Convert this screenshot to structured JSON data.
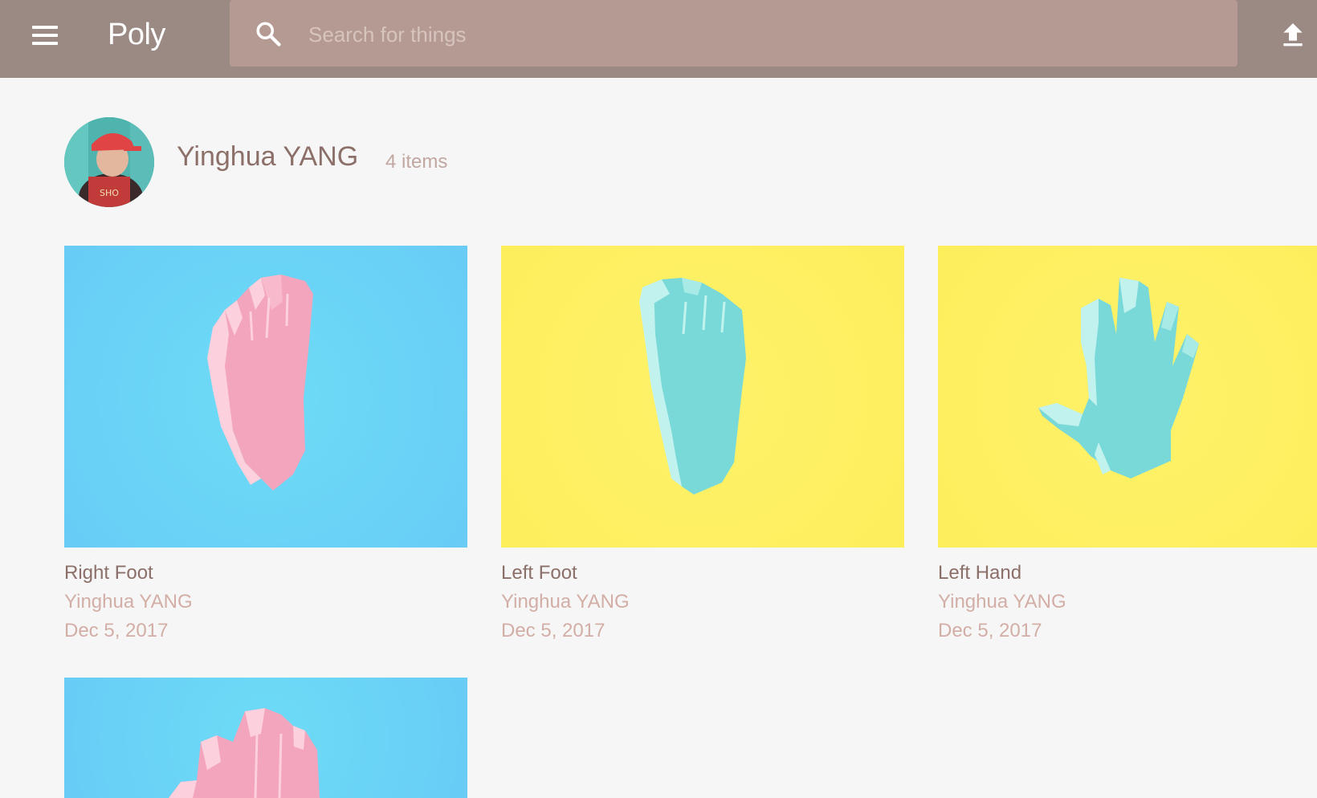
{
  "app": {
    "logo": "Poly",
    "menu_icon": "menu-icon",
    "upload_icon": "upload-icon"
  },
  "search": {
    "placeholder": "Search for things",
    "value": "",
    "icon": "search-icon"
  },
  "profile": {
    "name": "Yinghua YANG",
    "item_count": "4 items"
  },
  "colors": {
    "topbar": "#9b8a84",
    "search_bg": "#b49a92",
    "page_bg": "#f6f6f6",
    "blue_bg": "#68d3f6",
    "yellow_bg": "#fff066",
    "pink_model": "#f3a5bd",
    "teal_model": "#79d9d8"
  },
  "items": [
    {
      "title": "Right Foot",
      "author": "Yinghua YANG",
      "date": "Dec 5, 2017",
      "background": "blue",
      "model": "pink foot"
    },
    {
      "title": "Left Foot",
      "author": "Yinghua YANG",
      "date": "Dec 5, 2017",
      "background": "yellow",
      "model": "teal foot"
    },
    {
      "title": "Left Hand",
      "author": "Yinghua YANG",
      "date": "Dec 5, 2017",
      "background": "yellow",
      "model": "teal hand"
    },
    {
      "title": "",
      "author": "",
      "date": "",
      "background": "blue",
      "model": "pink hand"
    }
  ]
}
